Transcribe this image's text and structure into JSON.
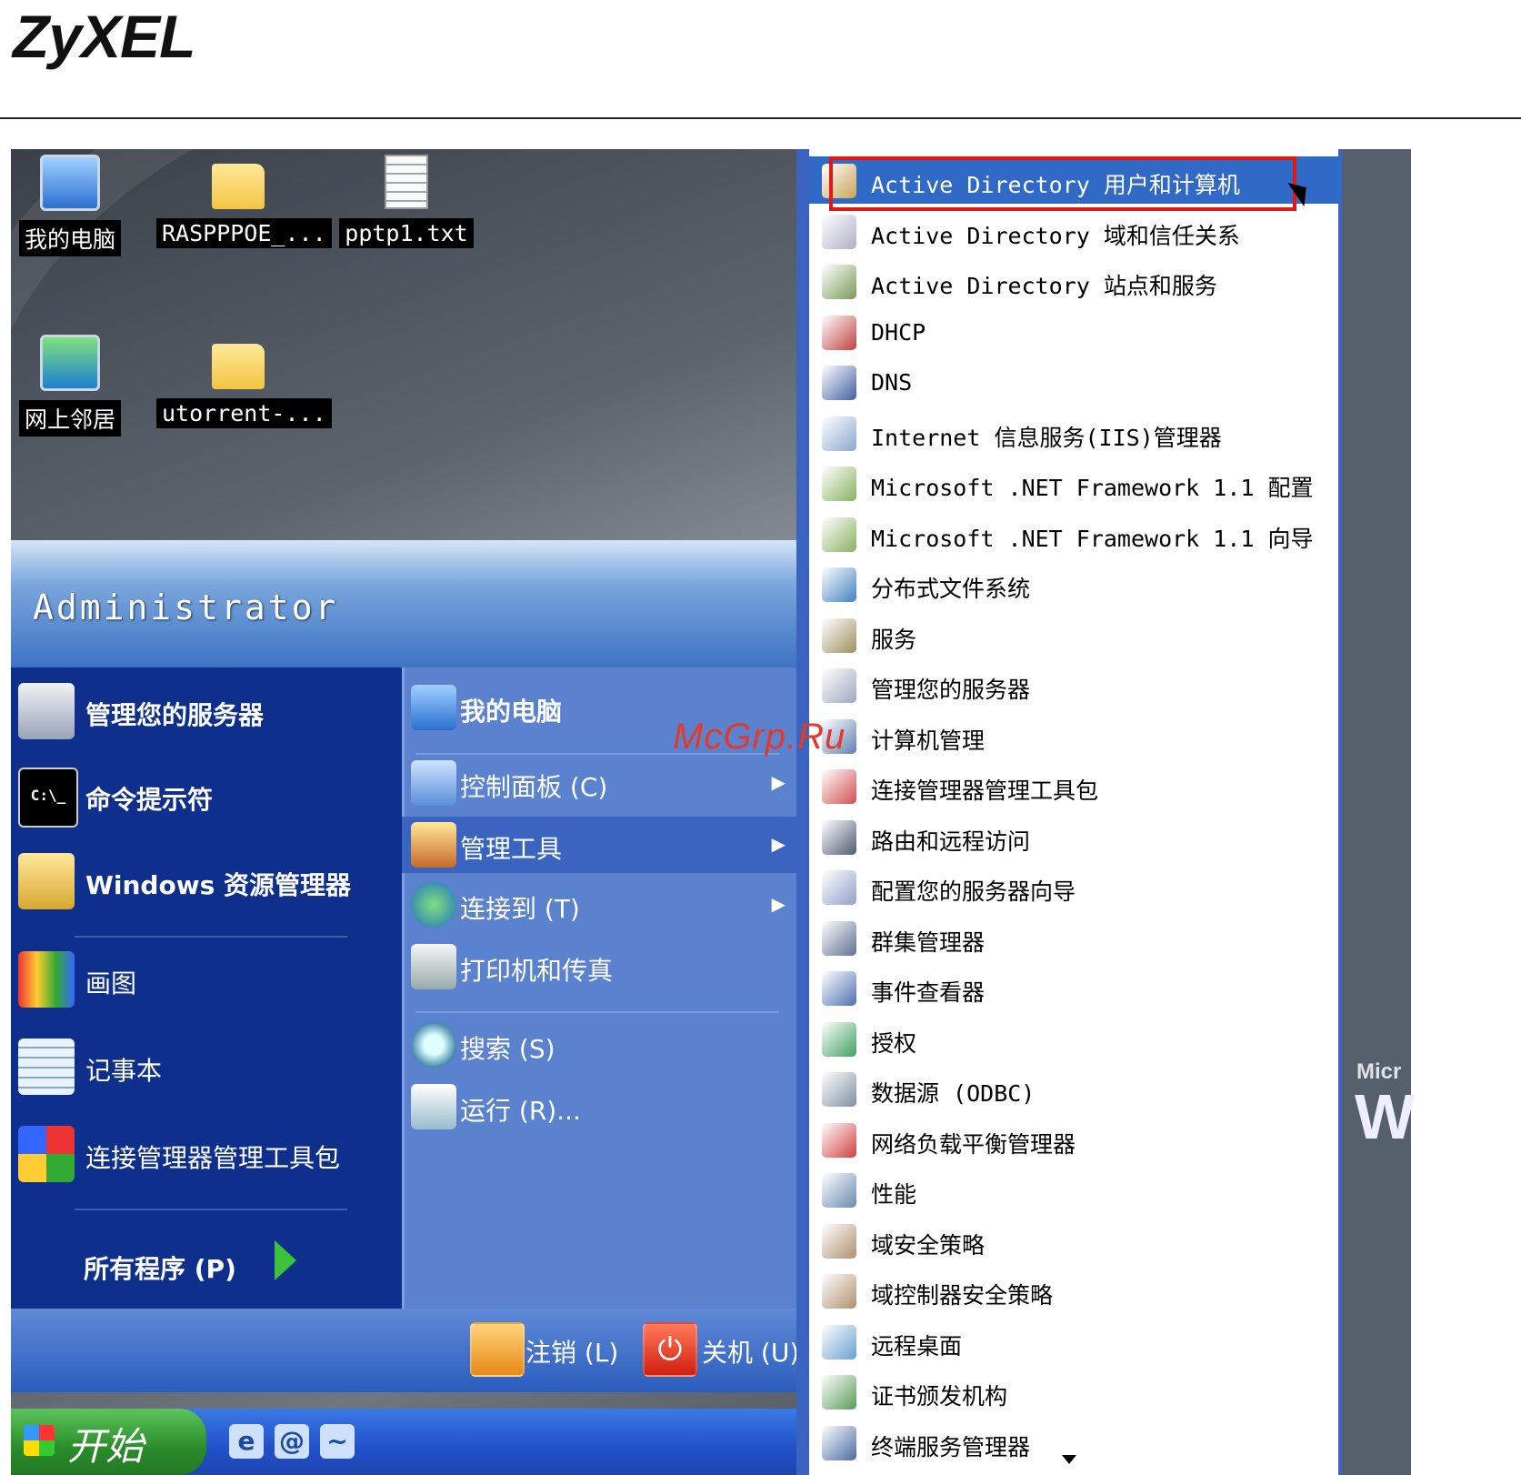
{
  "header": {
    "logo_text": "ZyXEL"
  },
  "watermark": "McGrp.Ru",
  "desktop": {
    "icons": [
      {
        "label": "我的电脑",
        "icon": "my-computer-icon"
      },
      {
        "label": "RASPPPOE_...",
        "icon": "folder-icon"
      },
      {
        "label": "pptp1.txt",
        "icon": "text-file-icon"
      },
      {
        "label": "网上邻居",
        "icon": "network-places-icon"
      },
      {
        "label": "utorrent-...",
        "icon": "folder-icon"
      }
    ],
    "background_text": {
      "line1": "Micr",
      "line2": "W"
    }
  },
  "start_menu": {
    "user": "Administrator",
    "pinned": [
      {
        "label": "管理您的服务器",
        "icon": "server-icon"
      },
      {
        "label": "命令提示符",
        "icon": "command-prompt-icon"
      },
      {
        "label": "Windows 资源管理器",
        "icon": "explorer-icon"
      }
    ],
    "recent": [
      {
        "label": "画图",
        "icon": "paint-icon"
      },
      {
        "label": "记事本",
        "icon": "notepad-icon"
      },
      {
        "label": "连接管理器管理工具包",
        "icon": "cmak-icon"
      }
    ],
    "all_programs": "所有程序 (P)",
    "right_items": [
      {
        "label": "我的电脑",
        "icon": "my-computer-icon",
        "submenu": false
      },
      {
        "label": "控制面板 (C)",
        "icon": "control-panel-icon",
        "submenu": true
      },
      {
        "label": "管理工具",
        "icon": "admin-tools-icon",
        "submenu": true
      },
      {
        "label": "连接到 (T)",
        "icon": "connect-to-icon",
        "submenu": true
      },
      {
        "label": "打印机和传真",
        "icon": "printer-icon",
        "submenu": false
      },
      {
        "label": "搜索 (S)",
        "icon": "search-icon",
        "submenu": false
      },
      {
        "label": "运行 (R)...",
        "icon": "run-icon",
        "submenu": false
      }
    ],
    "logoff": "注销 (L)",
    "shutdown": "关机 (U)"
  },
  "taskbar": {
    "start_label": "开始",
    "quick_launch": [
      "internet-explorer-icon",
      "outlook-express-icon",
      "media-icon"
    ]
  },
  "admin_tools": [
    "Active Directory 用户和计算机",
    "Active Directory 域和信任关系",
    "Active Directory 站点和服务",
    "DHCP",
    "DNS",
    "Internet 信息服务(IIS)管理器",
    "Microsoft .NET Framework 1.1 配置",
    "Microsoft .NET Framework 1.1 向导",
    "分布式文件系统",
    "服务",
    "管理您的服务器",
    "计算机管理",
    "连接管理器管理工具包",
    "路由和远程访问",
    "配置您的服务器向导",
    "群集管理器",
    "事件查看器",
    "授权",
    "数据源 (ODBC)",
    "网络负载平衡管理器",
    "性能",
    "域安全策略",
    "域控制器安全策略",
    "远程桌面",
    "证书颁发机构",
    "终端服务管理器"
  ],
  "colors": {
    "highlight": "#3169c6",
    "annotation_box": "#e01818"
  }
}
